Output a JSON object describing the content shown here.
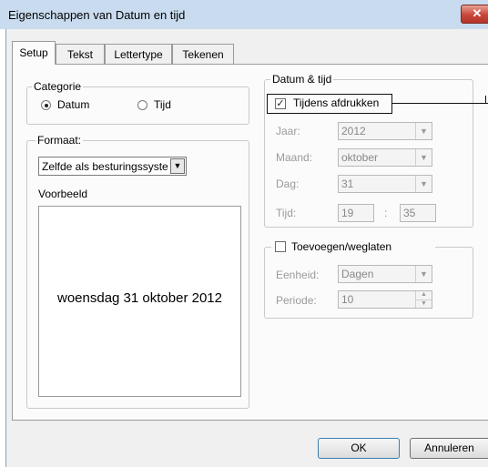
{
  "window": {
    "title": "Eigenschappen van Datum en tijd",
    "close_glyph": "✕"
  },
  "tabs": [
    {
      "label": "Setup",
      "active": true
    },
    {
      "label": "Tekst",
      "active": false
    },
    {
      "label": "Lettertype",
      "active": false
    },
    {
      "label": "Tekenen",
      "active": false
    }
  ],
  "categorie": {
    "label": "Categorie",
    "options": [
      {
        "label": "Datum",
        "selected": true
      },
      {
        "label": "Tijd",
        "selected": false
      }
    ]
  },
  "formaat": {
    "label": "Formaat:",
    "selected": "Zelfde als besturingssyste",
    "preview_label": "Voorbeeld",
    "preview_text": "woensdag 31 oktober 2012"
  },
  "datum_tijd": {
    "label": "Datum & tijd",
    "print_checkbox": {
      "label": "Tijdens afdrukken",
      "checked": true
    },
    "jaar": {
      "label": "Jaar:",
      "value": "2012"
    },
    "maand": {
      "label": "Maand:",
      "value": "oktober"
    },
    "dag": {
      "label": "Dag:",
      "value": "31"
    },
    "tijd": {
      "label": "Tijd:",
      "hours": "19",
      "separator": ":",
      "minutes": "35"
    }
  },
  "toevoegen": {
    "label": "Toevoegen/weglaten",
    "checked": false,
    "eenheid": {
      "label": "Eenheid:",
      "value": "Dagen"
    },
    "periode": {
      "label": "Periode:",
      "value": "10"
    }
  },
  "buttons": {
    "ok": "OK",
    "cancel": "Annuleren"
  }
}
